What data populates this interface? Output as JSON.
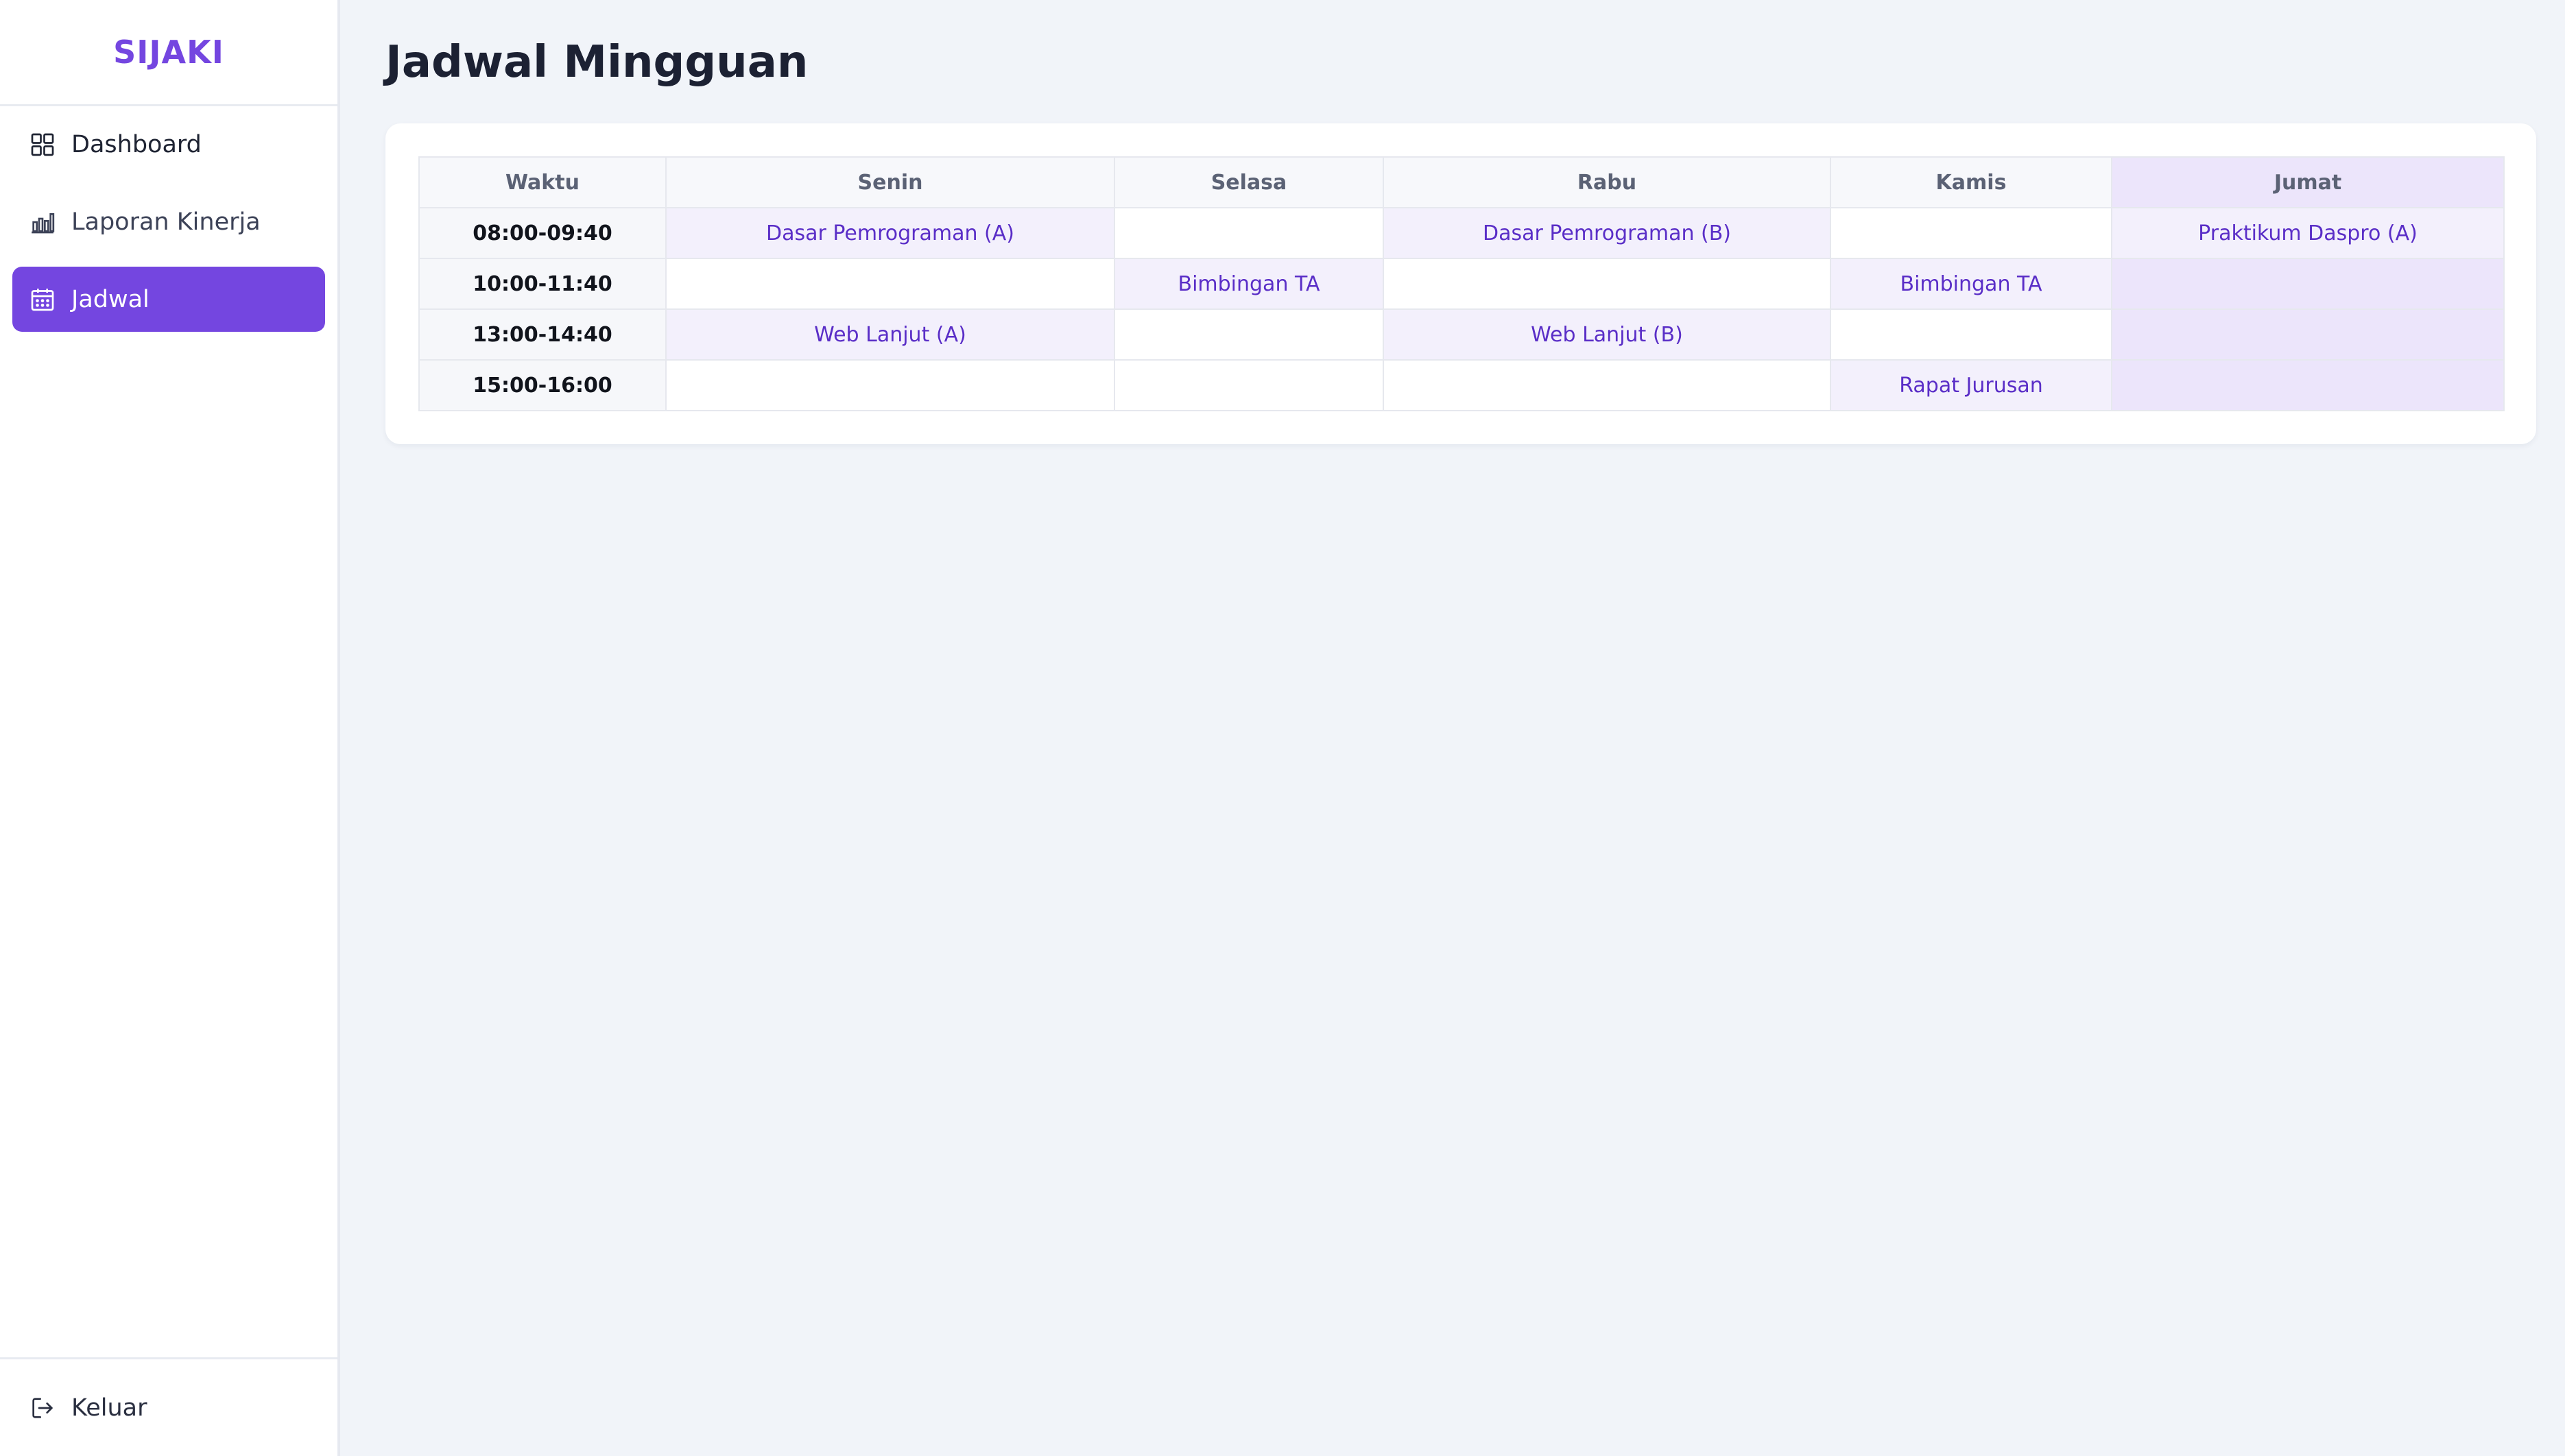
{
  "app": {
    "brand": "SIJAKI"
  },
  "sidebar": {
    "items": [
      {
        "label": "Dashboard",
        "icon": "grid-icon"
      },
      {
        "label": "Laporan Kinerja",
        "icon": "bar-chart-icon"
      },
      {
        "label": "Jadwal",
        "icon": "calendar-icon",
        "active": true
      }
    ],
    "logout_label": "Keluar",
    "logout_icon": "logout-icon"
  },
  "main": {
    "title": "Jadwal Mingguan"
  },
  "schedule": {
    "headers": [
      "Waktu",
      "Senin",
      "Selasa",
      "Rabu",
      "Kamis",
      "Jumat"
    ],
    "highlighted_day": "Jumat",
    "rows": [
      {
        "time": "08:00-09:40",
        "cells": [
          "Dasar Pemrograman (A)",
          "",
          "Dasar Pemrograman (B)",
          "",
          "Praktikum Daspro (A)"
        ]
      },
      {
        "time": "10:00-11:40",
        "cells": [
          "",
          "Bimbingan TA",
          "",
          "Bimbingan TA",
          ""
        ]
      },
      {
        "time": "13:00-14:40",
        "cells": [
          "Web Lanjut (A)",
          "",
          "Web Lanjut (B)",
          "",
          ""
        ]
      },
      {
        "time": "15:00-16:00",
        "cells": [
          "",
          "",
          "",
          "Rapat Jurusan",
          ""
        ]
      }
    ]
  },
  "colors": {
    "accent": "#7446e0",
    "filled_cell": "#f3f0fc",
    "highlight_column": "#ece5fb",
    "cell_text": "#5a2ec7",
    "background": "#f1f4f9"
  }
}
